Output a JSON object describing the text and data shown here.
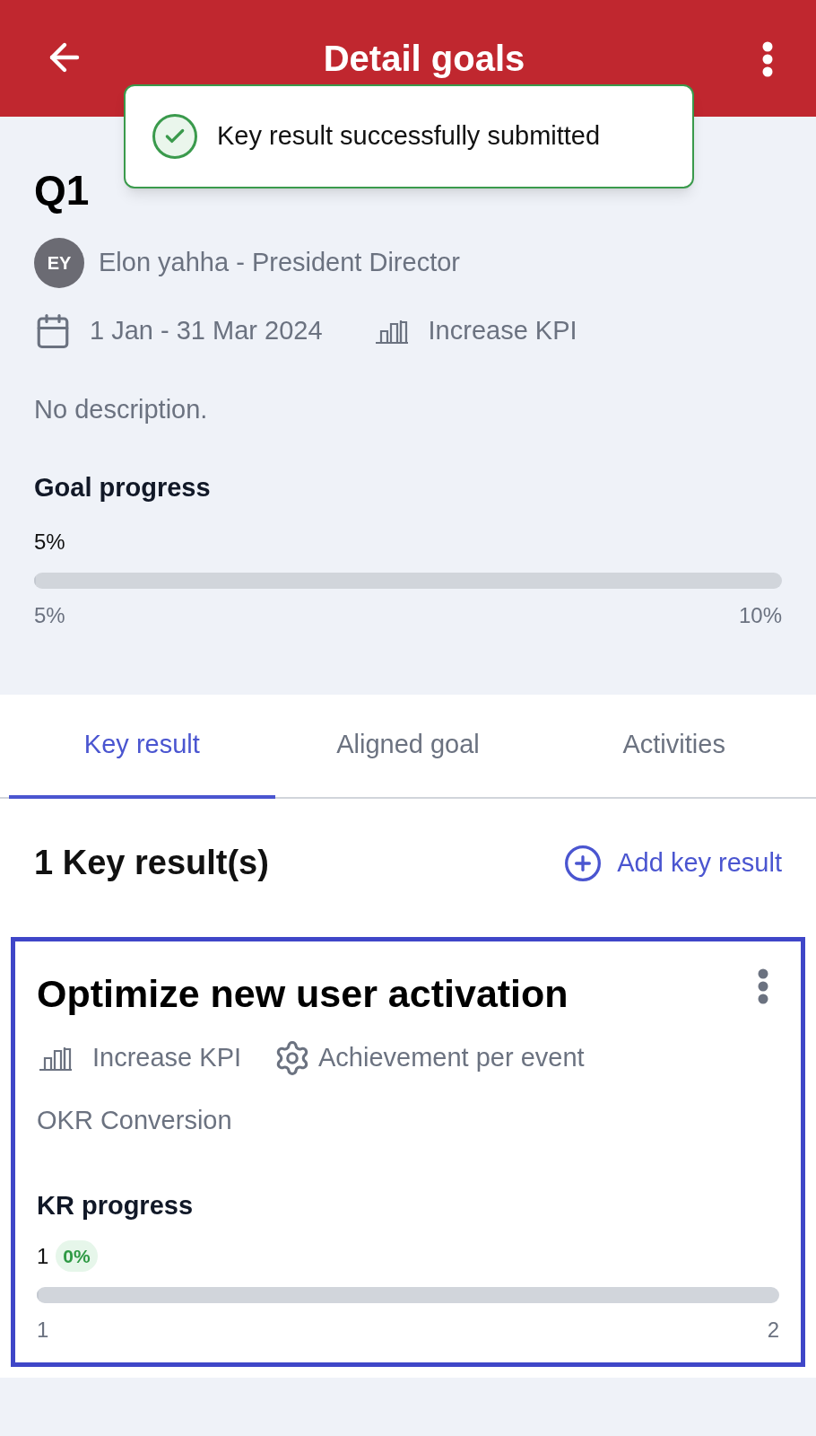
{
  "header": {
    "title": "Detail goals"
  },
  "toast": {
    "message": "Key result successfully submitted"
  },
  "goal": {
    "title": "Q1",
    "owner_initials": "EY",
    "owner": "Elon yahha - President Director",
    "period": "1 Jan - 31 Mar 2024",
    "type": "Increase KPI",
    "description": "No description.",
    "progress_label": "Goal progress",
    "current": "5%",
    "level": 0,
    "start": "5%",
    "target": "10%"
  },
  "tabs": [
    {
      "label": "Key result",
      "selected": true
    },
    {
      "label": "Aligned goal",
      "selected": false
    },
    {
      "label": "Activities",
      "selected": false
    }
  ],
  "key_results": {
    "count_label": "1 Key result(s)",
    "add_label": "Add key result",
    "items": [
      {
        "title": "Optimize new user activation",
        "type": "Increase KPI",
        "method": "Achievement per event",
        "goal": "OKR Conversion",
        "progress_label": "KR progress",
        "current": "1",
        "badge": "0%",
        "level": 0,
        "start": "1",
        "target": "2"
      }
    ]
  }
}
